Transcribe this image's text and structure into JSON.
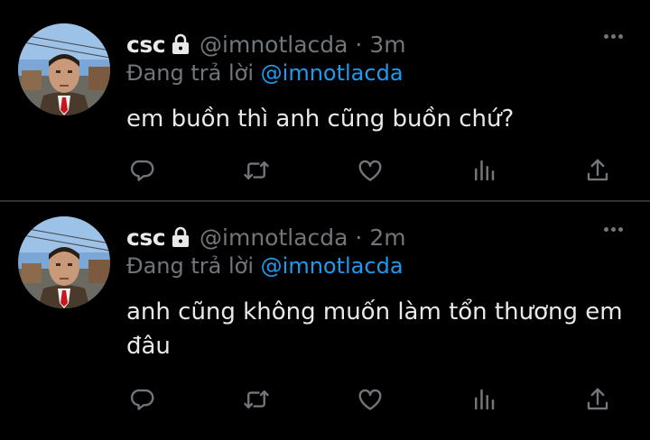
{
  "tweets": [
    {
      "name": "csc",
      "handle_time": "@imnotlacda · 3m",
      "reply_prefix": "Đang trả lời",
      "reply_to": "@imnotlacda",
      "text": "em buồn thì anh cũng buồn chứ?"
    },
    {
      "name": "csc",
      "handle_time": "@imnotlacda · 2m",
      "reply_prefix": "Đang trả lời",
      "reply_to": "@imnotlacda",
      "text": "anh cũng không muốn làm tổn thương em đâu"
    }
  ],
  "icons": [
    "lock-icon",
    "more-icon",
    "reply-icon",
    "retweet-icon",
    "like-icon",
    "views-icon",
    "share-icon"
  ],
  "colors": {
    "background": "#000000",
    "text": "#e7e9ea",
    "secondary": "#71767b",
    "accent": "#1d9bf0",
    "divider": "#2f3336"
  }
}
